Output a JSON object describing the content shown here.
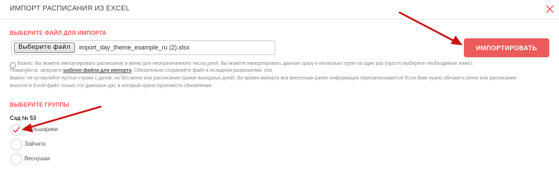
{
  "dialog": {
    "title": "ИМПОРТ РАСПИСАНИЯ ИЗ EXCEL",
    "close_icon": "close-icon"
  },
  "file_section": {
    "title": "ВЫБЕРИТЕ ФАЙЛ ДЛЯ ИМПОРТА",
    "choose_button_label": "Выберите файл",
    "file_name": "import_day_theme_example_ru (2).xlsx"
  },
  "import_button": {
    "label": "ИМПОРТИРОВАТЬ",
    "color": "#ec5b5b"
  },
  "notes": {
    "line1": "Важно: Вы можете импортировать расписание и меню для неограниченного числа дней. Вы можете импортировать данные сразу в несколько групп за один раз (просто выберите необходимые ниже).",
    "line2_before": "Пожалуйста, загрузите ",
    "line2_link": "шаблон файла для импорта",
    "line2_after": ". Обязательно сохраняйте файл в исходном разрешении: xlsx",
    "line3": "Важно: не оставляйте пустые строки с датой, но без меню или расписания (кроме выходных дней). Во время импорта вся внесенная ранее информация перезаписывается! Если Вам нужно обновить меню или расписание,",
    "line4": "вносите в Excel-файл только тот диапазон дат, в который нужно произвести обновление."
  },
  "groups_section": {
    "title": "ВЫБЕРИТЕ ГРУППЫ",
    "garden_name": "Сад № 53",
    "groups": [
      {
        "label": "Мальшарики",
        "selected": true
      },
      {
        "label": "Зайчата",
        "selected": false
      },
      {
        "label": "Веснушки",
        "selected": false
      }
    ]
  },
  "colors": {
    "accent": "#ee5555",
    "annotation_arrow": "#cc1111"
  }
}
